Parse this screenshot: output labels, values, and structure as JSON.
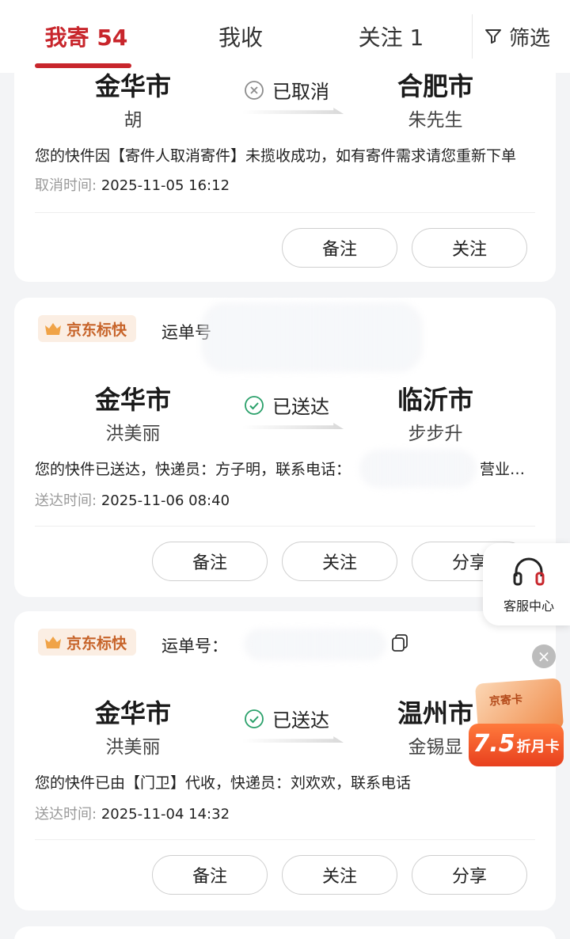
{
  "tabs": {
    "send_label": "我寄",
    "send_count": "54",
    "receive_label": "我收",
    "follow_label": "关注",
    "follow_count": "1",
    "filter_label": "筛选"
  },
  "colors": {
    "accent": "#c8262c",
    "success": "#2aa06a",
    "brand_orange": "#c7642a"
  },
  "orders": [
    {
      "from_city": "金华市",
      "from_person": "胡",
      "status": "已取消",
      "status_icon": "cancel-circle-icon",
      "to_city": "合肥市",
      "to_person": "朱先生",
      "message": "您的快件因【寄件人取消寄件】未揽收成功，如有寄件需求请您重新下单",
      "time_label": "取消时间:",
      "time": "2025-11-05 16:12",
      "buttons": [
        "备注",
        "关注"
      ]
    },
    {
      "brand": "京东标快",
      "waybill_label": "运单号",
      "from_city": "金华市",
      "from_person": "洪美丽",
      "status": "已送达",
      "status_icon": "check-circle-icon",
      "to_city": "临沂市",
      "to_person": "步步升",
      "message": "您的快件已送达，快递员：方子明，联系电话：",
      "message_tail": "营业…",
      "time_label": "送达时间:",
      "time": "2025-11-06 08:40",
      "buttons": [
        "备注",
        "关注",
        "分享"
      ]
    },
    {
      "brand": "京东标快",
      "waybill_label": "运单号：",
      "from_city": "金华市",
      "from_person": "洪美丽",
      "status": "已送达",
      "status_icon": "check-circle-icon",
      "to_city": "温州市",
      "to_person": "金锡显",
      "message": "您的快件已由【门卫】代收，快递员：刘欢欢，联系电话",
      "time_label": "送达时间:",
      "time": "2025-11-04 14:32",
      "buttons": [
        "备注",
        "关注",
        "分享"
      ]
    }
  ],
  "service": {
    "label": "客服中心"
  },
  "promo": {
    "card_text": "京寄卡",
    "discount": "7.5",
    "unit": "折月卡"
  }
}
